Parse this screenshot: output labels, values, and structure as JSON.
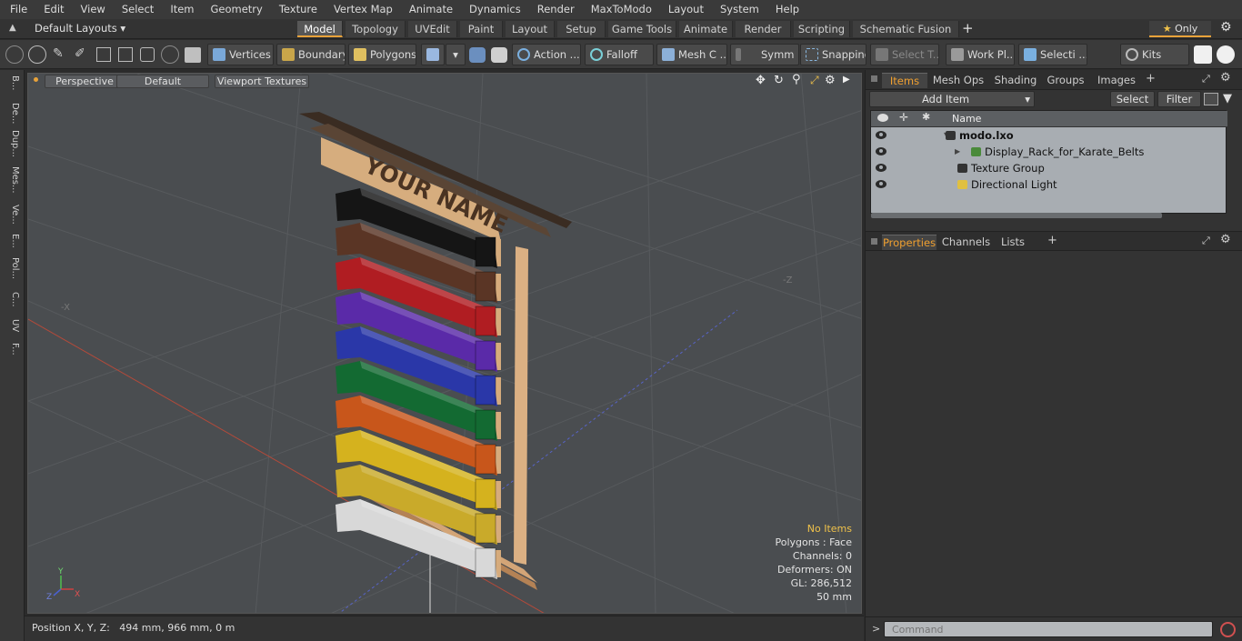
{
  "menubar": {
    "items": [
      "File",
      "Edit",
      "View",
      "Select",
      "Item",
      "Geometry",
      "Texture",
      "Vertex Map",
      "Animate",
      "Dynamics",
      "Render",
      "MaxToModo",
      "Layout",
      "System",
      "Help"
    ]
  },
  "layoutbar": {
    "layout_select": "Default Layouts",
    "tabs": [
      "Model",
      "Topology",
      "UVEdit",
      "Paint",
      "Layout",
      "Setup",
      "Game Tools",
      "Animate",
      "Render",
      "Scripting",
      "Schematic Fusion"
    ],
    "active_tab": "Model",
    "only_label": "Only"
  },
  "toolbar": {
    "vertices": "Vertices",
    "boundary": "Boundary",
    "polygons": "Polygons",
    "action": "Action ...",
    "falloff": "Falloff",
    "mesh": "Mesh C ...",
    "symm": "Symm ...",
    "snapping": "Snapping",
    "select_t": "Select T...",
    "work_pl": "Work Pl...",
    "selecti": "Selecti ...",
    "kits": "Kits"
  },
  "leftstrip": {
    "tabs": [
      "B...",
      "De...",
      "Dup...",
      "Mes...",
      "Ve...",
      "E...",
      "Pol...",
      "C...",
      "UV",
      "F..."
    ]
  },
  "viewport": {
    "view_mode": "Perspective",
    "shading": "Default",
    "textures": "Viewport Textures",
    "nameplate": "YOUR NAME",
    "info": {
      "no_items": "No Items",
      "polygons": "Polygons : Face",
      "channels": "Channels: 0",
      "deformers": "Deformers: ON",
      "gl": "GL: 286,512",
      "scale": "50 mm"
    },
    "belt_colors": [
      "#151515",
      "#5a3525",
      "#b01d22",
      "#5a2aa8",
      "#2a37a8",
      "#136a32",
      "#c8561b",
      "#d5b21e",
      "#c9aa2a",
      "#d8d8d8"
    ]
  },
  "statusbar": {
    "position": "Position X, Y, Z:   494 mm, 966 mm, 0 m"
  },
  "rightpanel": {
    "top_tabs": [
      "Items",
      "Mesh Ops",
      "Shading",
      "Groups",
      "Images"
    ],
    "active_top_tab": "Items",
    "add_item": "Add Item",
    "select": "Select",
    "filter": "Filter",
    "column_name": "Name",
    "items": [
      {
        "name": "modo.lxo",
        "type": "scene"
      },
      {
        "name": "Display_Rack_for_Karate_Belts",
        "type": "mesh"
      },
      {
        "name": "Texture Group",
        "type": "texture"
      },
      {
        "name": "Directional Light",
        "type": "light"
      }
    ],
    "bottom_tabs": [
      "Properties",
      "Channels",
      "Lists"
    ],
    "active_bottom_tab": "Properties",
    "command_placeholder": "Command"
  },
  "colors": {
    "accent": "#e8a23a",
    "viewport_bg": "#4a4d50"
  }
}
